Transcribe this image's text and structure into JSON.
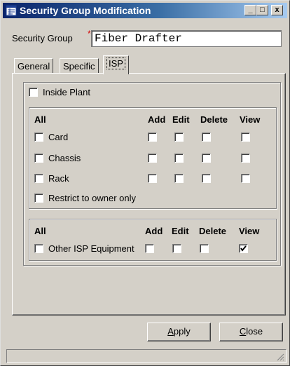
{
  "window": {
    "title": "Security Group Modification",
    "minimize": "_",
    "maximize": "□",
    "close": "x"
  },
  "security_group": {
    "label": "Security Group",
    "required_mark": "*",
    "value": "Fiber Drafter"
  },
  "tabs": [
    {
      "label": "General"
    },
    {
      "label": "Specific"
    },
    {
      "label": "ISP",
      "active": true
    }
  ],
  "isp": {
    "inside_plant": {
      "label": "Inside Plant",
      "checked": false
    },
    "group1": {
      "headers": {
        "all": "All",
        "add": "Add",
        "edit": "Edit",
        "delete": "Delete",
        "view": "View"
      },
      "rows": [
        {
          "label": "Card",
          "add": false,
          "edit": false,
          "delete": false,
          "view": false
        },
        {
          "label": "Chassis",
          "add": false,
          "edit": false,
          "delete": false,
          "view": false
        },
        {
          "label": "Rack",
          "add": false,
          "edit": false,
          "delete": false,
          "view": false
        }
      ],
      "restrict": {
        "label": "Restrict to owner only",
        "checked": false
      }
    },
    "group2": {
      "headers": {
        "all": "All",
        "add": "Add",
        "edit": "Edit",
        "delete": "Delete",
        "view": "View"
      },
      "rows": [
        {
          "label": "Other ISP Equipment",
          "add": false,
          "edit": false,
          "delete": false,
          "view": true
        }
      ]
    }
  },
  "buttons": {
    "apply": {
      "mnemonic": "A",
      "rest": "pply"
    },
    "close": {
      "mnemonic": "C",
      "rest": "lose"
    }
  },
  "colors": {
    "face": "#d4d0c8",
    "titlebar_start": "#0a246a",
    "titlebar_end": "#a6caf0",
    "required": "#d40000"
  }
}
